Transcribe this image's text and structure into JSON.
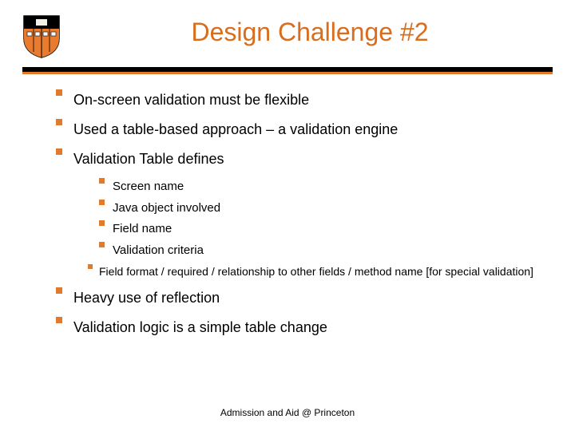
{
  "title": "Design Challenge #2",
  "bullets_lvl1": {
    "b0": "On-screen validation must be flexible",
    "b1": "Used a table-based approach – a validation engine",
    "b2": "Validation Table defines",
    "b3": "Heavy use of reflection",
    "b4": "Validation logic is a simple table change"
  },
  "bullets_lvl2": {
    "s0": "Screen name",
    "s1": "Java object involved",
    "s2": "Field name",
    "s3": "Validation criteria"
  },
  "bullets_lvl3": {
    "t0": "Field format / required / relationship to other fields / method name [for special validation]"
  },
  "footer": "Admission and Aid @ Princeton",
  "colors": {
    "accent": "#e07a2f",
    "title": "#d96c1d"
  }
}
